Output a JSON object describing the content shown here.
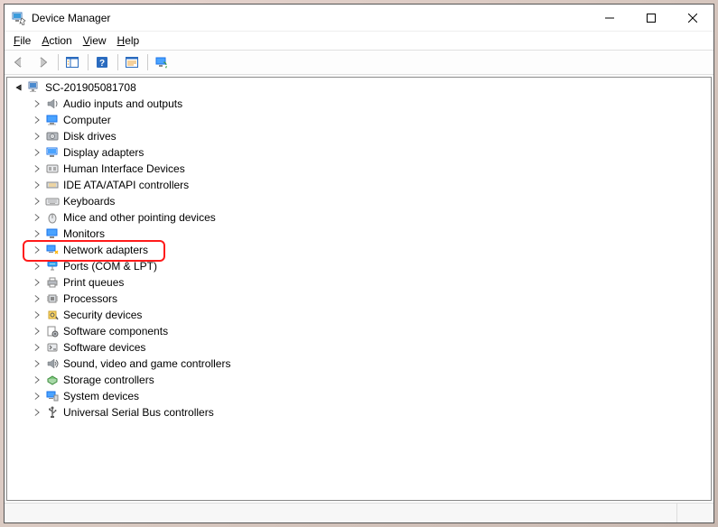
{
  "window": {
    "title": "Device Manager"
  },
  "menu": {
    "file": "File",
    "action": "Action",
    "view": "View",
    "help": "Help"
  },
  "tree": {
    "root": "SC-201905081708",
    "items": [
      {
        "label": "Audio inputs and outputs",
        "icon": "audio"
      },
      {
        "label": "Computer",
        "icon": "computer"
      },
      {
        "label": "Disk drives",
        "icon": "disk"
      },
      {
        "label": "Display adapters",
        "icon": "display"
      },
      {
        "label": "Human Interface Devices",
        "icon": "hid"
      },
      {
        "label": "IDE ATA/ATAPI controllers",
        "icon": "ide"
      },
      {
        "label": "Keyboards",
        "icon": "keyboard"
      },
      {
        "label": "Mice and other pointing devices",
        "icon": "mouse"
      },
      {
        "label": "Monitors",
        "icon": "monitor"
      },
      {
        "label": "Network adapters",
        "icon": "network",
        "highlighted": true
      },
      {
        "label": "Ports (COM & LPT)",
        "icon": "ports"
      },
      {
        "label": "Print queues",
        "icon": "printer"
      },
      {
        "label": "Processors",
        "icon": "cpu"
      },
      {
        "label": "Security devices",
        "icon": "security"
      },
      {
        "label": "Software components",
        "icon": "swcomp"
      },
      {
        "label": "Software devices",
        "icon": "swdev"
      },
      {
        "label": "Sound, video and game controllers",
        "icon": "sound"
      },
      {
        "label": "Storage controllers",
        "icon": "storage"
      },
      {
        "label": "System devices",
        "icon": "system"
      },
      {
        "label": "Universal Serial Bus controllers",
        "icon": "usb"
      }
    ]
  }
}
